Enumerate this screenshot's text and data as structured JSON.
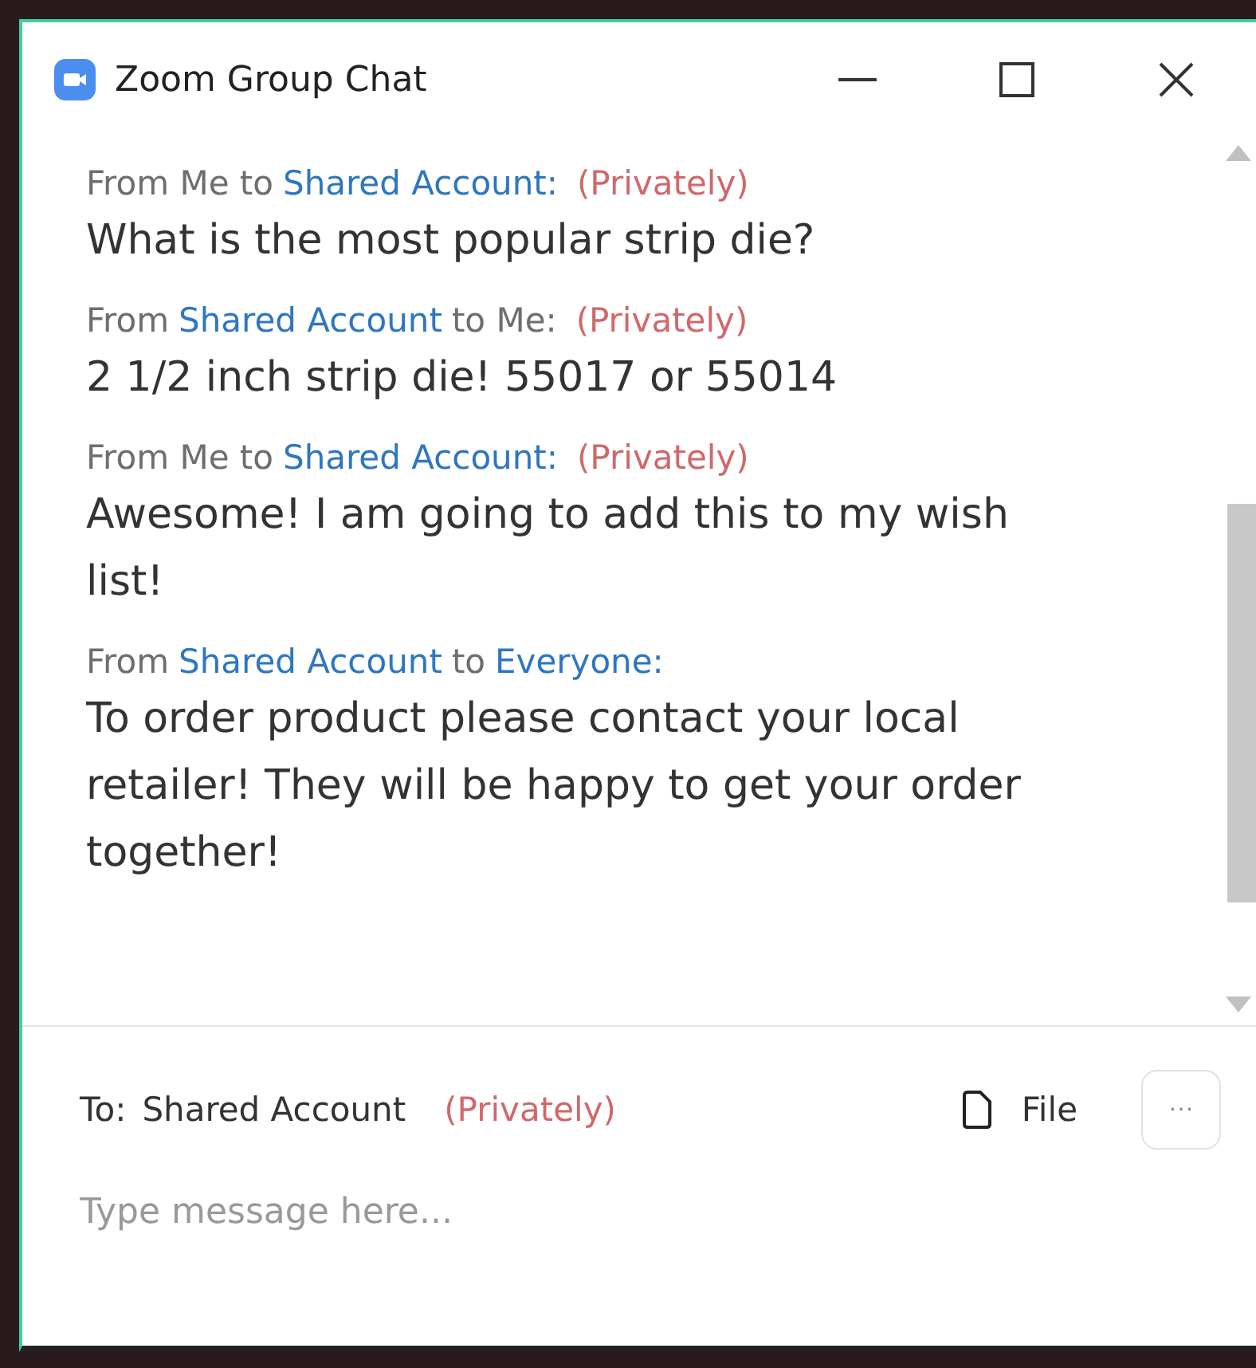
{
  "window": {
    "title": "Zoom Group Chat"
  },
  "messages": [
    {
      "header": [
        {
          "text": "From Me to",
          "kind": "plain"
        },
        {
          "text": "Shared Account:",
          "kind": "name"
        },
        {
          "text": "(Privately)",
          "kind": "private"
        }
      ],
      "body": "What is the most popular strip die?"
    },
    {
      "header": [
        {
          "text": "From",
          "kind": "plain"
        },
        {
          "text": "Shared Account",
          "kind": "name"
        },
        {
          "text": "to Me:",
          "kind": "plain"
        },
        {
          "text": "(Privately)",
          "kind": "private"
        }
      ],
      "body": "2 1/2 inch strip die! 55017 or 55014"
    },
    {
      "header": [
        {
          "text": "From Me to",
          "kind": "plain"
        },
        {
          "text": "Shared Account:",
          "kind": "name"
        },
        {
          "text": "(Privately)",
          "kind": "private"
        }
      ],
      "body": "Awesome! I am going to add this to my wish list!"
    },
    {
      "header": [
        {
          "text": "From",
          "kind": "plain"
        },
        {
          "text": "Shared Account",
          "kind": "name"
        },
        {
          "text": "to",
          "kind": "plain"
        },
        {
          "text": "Everyone:",
          "kind": "name"
        }
      ],
      "body": "To order product please contact your local retailer! They will be happy to get your order together!"
    }
  ],
  "composer": {
    "to_label": "To:",
    "recipient": "Shared Account",
    "privacy": "(Privately)",
    "file_button": "File",
    "more_button": "···",
    "placeholder": "Type message here..."
  }
}
